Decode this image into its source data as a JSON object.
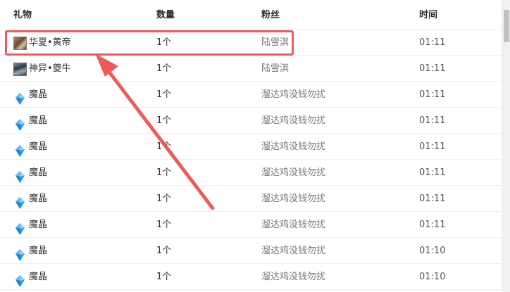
{
  "table": {
    "headers": {
      "gift": "礼物",
      "quantity": "数量",
      "fan": "粉丝",
      "time": "时间"
    },
    "rows": [
      {
        "gift": "华夏•黄帝",
        "icon": "huaxia-huangdi-avatar-icon",
        "quantity": "1个",
        "fan": "陆雪淇",
        "time": "01:11"
      },
      {
        "gift": "神异•夔牛",
        "icon": "shenyi-kuiniu-avatar-icon",
        "quantity": "1个",
        "fan": "陆雪淇",
        "time": "01:11"
      },
      {
        "gift": "魔晶",
        "icon": "crystal-icon",
        "quantity": "1个",
        "fan": "溜达鸡没钱勿扰",
        "time": "01:11"
      },
      {
        "gift": "魔晶",
        "icon": "crystal-icon",
        "quantity": "1个",
        "fan": "溜达鸡没钱勿扰",
        "time": "01:11"
      },
      {
        "gift": "魔晶",
        "icon": "crystal-icon",
        "quantity": "1个",
        "fan": "溜达鸡没钱勿扰",
        "time": "01:11"
      },
      {
        "gift": "魔晶",
        "icon": "crystal-icon",
        "quantity": "1个",
        "fan": "溜达鸡没钱勿扰",
        "time": "01:11"
      },
      {
        "gift": "魔晶",
        "icon": "crystal-icon",
        "quantity": "1个",
        "fan": "溜达鸡没钱勿扰",
        "time": "01:11"
      },
      {
        "gift": "魔晶",
        "icon": "crystal-icon",
        "quantity": "1个",
        "fan": "溜达鸡没钱勿扰",
        "time": "01:11"
      },
      {
        "gift": "魔晶",
        "icon": "crystal-icon",
        "quantity": "1个",
        "fan": "溜达鸡没钱勿扰",
        "time": "01:10"
      },
      {
        "gift": "魔晶",
        "icon": "crystal-icon",
        "quantity": "1个",
        "fan": "溜达鸡没钱勿扰",
        "time": "01:10"
      }
    ]
  },
  "annotation": {
    "highlight_color": "#ec5b5b",
    "highlighted_row": 0
  },
  "colors": {
    "crystal": "#2f9be6",
    "row_border": "#eeeeee"
  }
}
